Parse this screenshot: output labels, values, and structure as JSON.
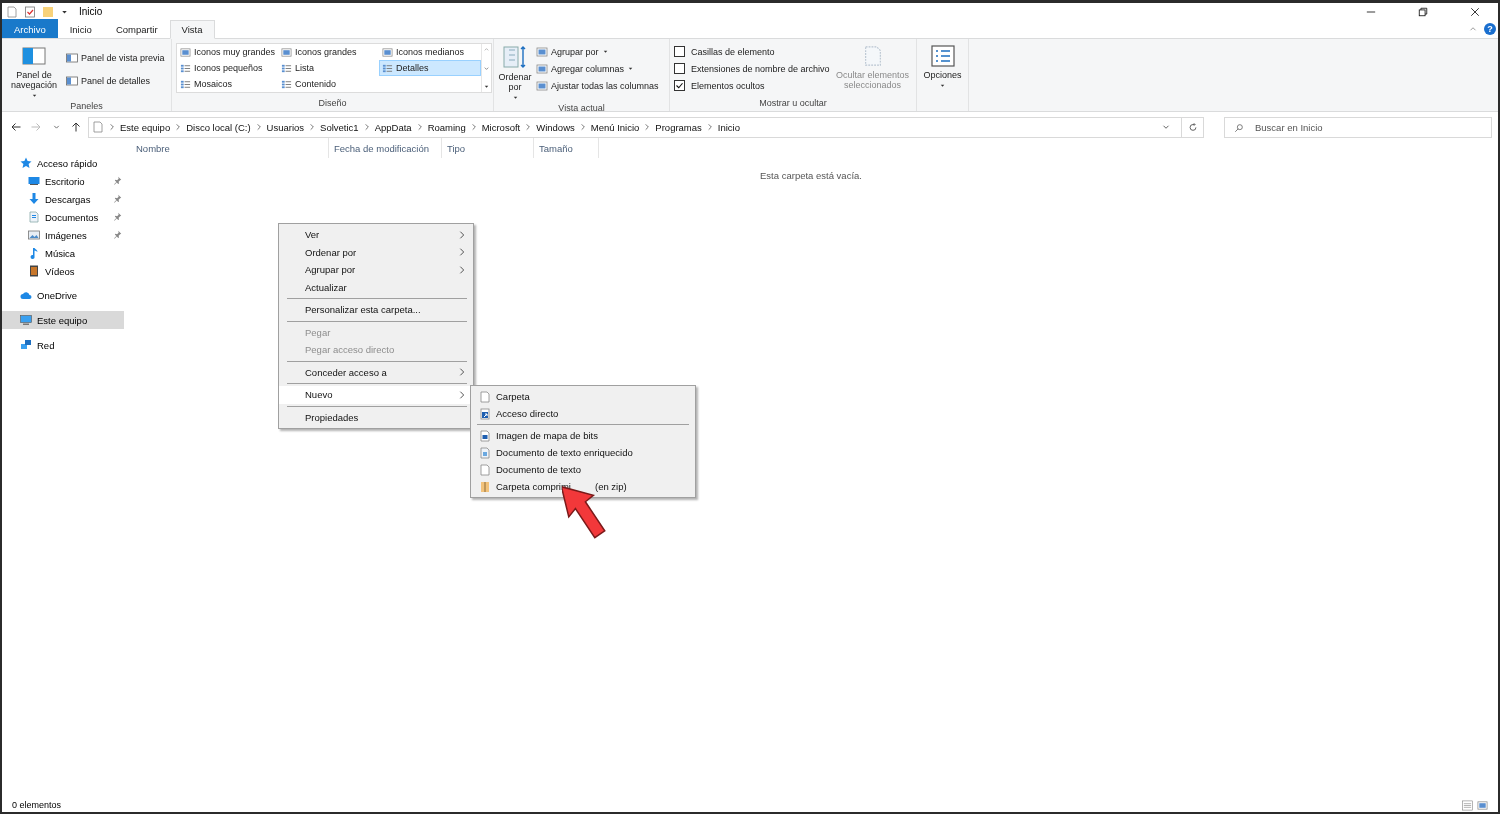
{
  "window": {
    "title": "Inicio",
    "help": "?"
  },
  "ribbon_tabs": [
    {
      "label": "Archivo",
      "kind": "file",
      "selected": false
    },
    {
      "label": "Inicio",
      "kind": "tab",
      "selected": false
    },
    {
      "label": "Compartir",
      "kind": "tab",
      "selected": false
    },
    {
      "label": "Vista",
      "kind": "tab",
      "selected": true
    }
  ],
  "ribbon": {
    "panels": {
      "label": "Paneles",
      "nav_button": "Panel de navegación",
      "items": [
        "Panel de vista previa",
        "Panel de detalles"
      ]
    },
    "layout": {
      "label": "Diseño",
      "items": [
        {
          "label": "Iconos muy grandes",
          "selected": false
        },
        {
          "label": "Iconos grandes",
          "selected": false
        },
        {
          "label": "Iconos medianos",
          "selected": false
        },
        {
          "label": "Iconos pequeños",
          "selected": false
        },
        {
          "label": "Lista",
          "selected": false
        },
        {
          "label": "Detalles",
          "selected": true
        },
        {
          "label": "Mosaicos",
          "selected": false
        },
        {
          "label": "Contenido",
          "selected": false
        }
      ]
    },
    "current_view": {
      "label": "Vista actual",
      "sort_button": "Ordenar por",
      "items": [
        {
          "label": "Agrupar por",
          "dropdown": true
        },
        {
          "label": "Agregar columnas",
          "dropdown": true
        },
        {
          "label": "Ajustar todas las columnas",
          "dropdown": false
        }
      ]
    },
    "show_hide": {
      "label": "Mostrar u ocultar",
      "checkboxes": [
        {
          "label": "Casillas de elemento",
          "checked": false
        },
        {
          "label": "Extensiones de nombre de archivo",
          "checked": false
        },
        {
          "label": "Elementos ocultos",
          "checked": true
        }
      ],
      "hide_button": {
        "label": "Ocultar elementos seleccionados",
        "disabled": true
      }
    },
    "options": {
      "label": "Opciones"
    }
  },
  "address_bar": {
    "path": [
      "Este equipo",
      "Disco local (C:)",
      "Usuarios",
      "Solvetic1",
      "AppData",
      "Roaming",
      "Microsoft",
      "Windows",
      "Menú Inicio",
      "Programas",
      "Inicio"
    ],
    "search_placeholder": "Buscar en Inicio"
  },
  "columns": [
    "Nombre",
    "Fecha de modificación",
    "Tipo",
    "Tamaño"
  ],
  "nav_pane": [
    {
      "label": "Acceso rápido",
      "selected": false,
      "children": [
        {
          "label": "Escritorio",
          "pinned": true,
          "selected": false
        },
        {
          "label": "Descargas",
          "pinned": true,
          "selected": false
        },
        {
          "label": "Documentos",
          "pinned": true,
          "selected": false
        },
        {
          "label": "Imágenes",
          "pinned": true,
          "selected": false
        },
        {
          "label": "Música",
          "pinned": false,
          "selected": false
        },
        {
          "label": "Vídeos",
          "pinned": false,
          "selected": false
        }
      ]
    },
    {
      "label": "OneDrive",
      "selected": false
    },
    {
      "label": "Este equipo",
      "selected": true
    },
    {
      "label": "Red",
      "selected": false
    }
  ],
  "empty_message": "Esta carpeta está vacía.",
  "context_menu": [
    {
      "kind": "item",
      "label": "Ver",
      "submenu": true,
      "disabled": false,
      "selected": false
    },
    {
      "kind": "item",
      "label": "Ordenar por",
      "submenu": true,
      "disabled": false,
      "selected": false
    },
    {
      "kind": "item",
      "label": "Agrupar por",
      "submenu": true,
      "disabled": false,
      "selected": false
    },
    {
      "kind": "item",
      "label": "Actualizar",
      "submenu": false,
      "disabled": false,
      "selected": false
    },
    {
      "kind": "separator"
    },
    {
      "kind": "item",
      "label": "Personalizar esta carpeta...",
      "submenu": false,
      "disabled": false,
      "selected": false
    },
    {
      "kind": "separator"
    },
    {
      "kind": "item",
      "label": "Pegar",
      "submenu": false,
      "disabled": true,
      "selected": false
    },
    {
      "kind": "item",
      "label": "Pegar acceso directo",
      "submenu": false,
      "disabled": true,
      "selected": false
    },
    {
      "kind": "separator"
    },
    {
      "kind": "item",
      "label": "Conceder acceso a",
      "submenu": true,
      "disabled": false,
      "selected": false
    },
    {
      "kind": "separator"
    },
    {
      "kind": "item",
      "label": "Nuevo",
      "submenu": true,
      "disabled": false,
      "selected": true
    },
    {
      "kind": "separator"
    },
    {
      "kind": "item",
      "label": "Propiedades",
      "submenu": false,
      "disabled": false,
      "selected": false
    }
  ],
  "new_submenu": [
    {
      "kind": "item",
      "label": "Carpeta"
    },
    {
      "kind": "item",
      "label": "Acceso directo"
    },
    {
      "kind": "separator"
    },
    {
      "kind": "item",
      "label": "Imagen de mapa de bits"
    },
    {
      "kind": "item",
      "label": "Documento de texto enriquecido"
    },
    {
      "kind": "item",
      "label": "Documento de texto"
    },
    {
      "kind": "covered",
      "label": "Carpeta comprimi",
      "label_after": "(en zip)"
    }
  ],
  "status_bar": {
    "count": "0 elementos"
  }
}
